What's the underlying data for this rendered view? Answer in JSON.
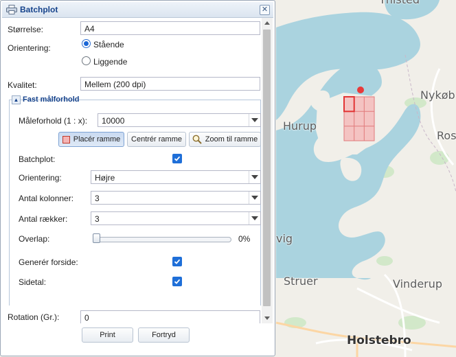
{
  "map": {
    "labels": {
      "thisted": "Thisted",
      "nykob": "Nykøb",
      "hurup": "Hurup",
      "ros": "Ros",
      "vig": "vig",
      "struer": "Struer",
      "vinderup": "Vinderup",
      "holstebro": "Holstebro"
    },
    "colors": {
      "land": "#f1efe9",
      "water": "#aad3df",
      "forest": "#cde7c4",
      "frame": "#f4b4b4",
      "frame_border": "#e07a7a",
      "marker": "#e83a3a"
    }
  },
  "dialog": {
    "title": "Batchplot",
    "close_label": "✕",
    "size": {
      "label": "Størrelse:",
      "value": "A4"
    },
    "orientation": {
      "label": "Orientering:",
      "options": [
        "Stående",
        "Liggende"
      ],
      "selected": "Stående"
    },
    "quality": {
      "label": "Kvalitet:",
      "value": "Mellem (200 dpi)"
    },
    "fixed_scale": {
      "legend": "Fast målforhold",
      "toggle": "▲",
      "scale": {
        "label": "Måleforhold (1 : x):",
        "value": "10000"
      },
      "buttons": {
        "place": "Placér ramme",
        "center": "Centrér ramme",
        "zoom": "Zoom til ramme"
      },
      "batchplot": {
        "label": "Batchplot:",
        "checked": true
      },
      "orientation": {
        "label": "Orientering:",
        "value": "Højre"
      },
      "columns": {
        "label": "Antal kolonner:",
        "value": "3"
      },
      "rows": {
        "label": "Antal rækker:",
        "value": "3"
      },
      "overlap": {
        "label": "Overlap:",
        "value_text": "0%",
        "value": 0
      },
      "frontpage": {
        "label": "Generér forside:",
        "checked": true
      },
      "page_numbers": {
        "label": "Sidetal:",
        "checked": true
      }
    },
    "rotation": {
      "label": "Rotation (Gr.):",
      "value": "0"
    },
    "print_label": "Print",
    "cancel_label": "Fortryd"
  }
}
